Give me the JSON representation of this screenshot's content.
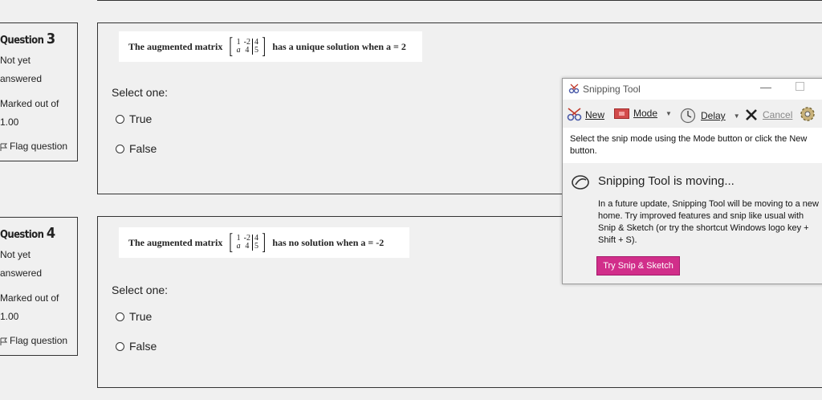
{
  "questions": [
    {
      "label": "Question",
      "number": "3",
      "status": [
        "Not yet",
        "answered"
      ],
      "marked": [
        "Marked out of",
        "1.00"
      ],
      "flag": "Flag question",
      "text_before": "The augmented matrix",
      "matrix": {
        "r1": [
          "1",
          "-2",
          "4"
        ],
        "r2": [
          "a",
          "4",
          "5"
        ]
      },
      "text_after": "has a unique solution when a = 2",
      "select": "Select one:",
      "options": [
        "True",
        "False"
      ]
    },
    {
      "label": "Question",
      "number": "4",
      "status": [
        "Not yet",
        "answered"
      ],
      "marked": [
        "Marked out of",
        "1.00"
      ],
      "flag": "Flag question",
      "text_before": "The augmented matrix",
      "matrix": {
        "r1": [
          "1",
          "-2",
          "4"
        ],
        "r2": [
          "a",
          "4",
          "5"
        ]
      },
      "text_after": "has no solution when a = -2",
      "select": "Select one:",
      "options": [
        "True",
        "False"
      ]
    }
  ],
  "snip": {
    "title": "Snipping Tool",
    "min": "—",
    "toolbar": {
      "new": "New",
      "mode": "Mode",
      "delay": "Delay",
      "cancel": "Cancel"
    },
    "hint": "Select the snip mode using the Mode button or click the New button.",
    "moving_title": "Snipping Tool is moving...",
    "moving_body": "In a future update, Snipping Tool will be moving to a new home. Try improved features and snip like usual with Snip & Sketch (or try the shortcut Windows logo key + Shift + S).",
    "try_button": "Try Snip & Sketch",
    "accent": "#d12e8a"
  }
}
